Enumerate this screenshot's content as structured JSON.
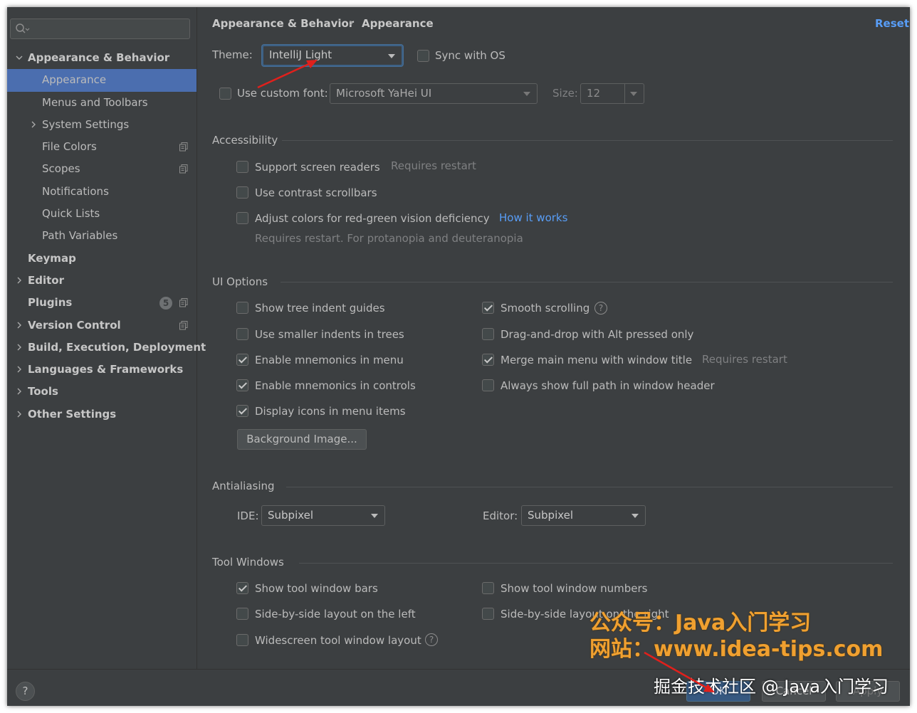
{
  "sidebar": {
    "search_placeholder": "",
    "items": [
      {
        "label": "Appearance & Behavior",
        "level": 1,
        "expanded": true
      },
      {
        "label": "Appearance",
        "level": 2,
        "selected": true
      },
      {
        "label": "Menus and Toolbars",
        "level": 2
      },
      {
        "label": "System Settings",
        "level": 2,
        "collapsed": true
      },
      {
        "label": "File Colors",
        "level": 2,
        "copy_icon": true
      },
      {
        "label": "Scopes",
        "level": 2,
        "copy_icon": true
      },
      {
        "label": "Notifications",
        "level": 2
      },
      {
        "label": "Quick Lists",
        "level": 2
      },
      {
        "label": "Path Variables",
        "level": 2
      },
      {
        "label": "Keymap",
        "level": 1
      },
      {
        "label": "Editor",
        "level": 1,
        "collapsed": true
      },
      {
        "label": "Plugins",
        "level": 1,
        "badge": "5",
        "copy_icon": true
      },
      {
        "label": "Version Control",
        "level": 1,
        "collapsed": true,
        "copy_icon": true
      },
      {
        "label": "Build, Execution, Deployment",
        "level": 1,
        "collapsed": true
      },
      {
        "label": "Languages & Frameworks",
        "level": 1,
        "collapsed": true
      },
      {
        "label": "Tools",
        "level": 1,
        "collapsed": true
      },
      {
        "label": "Other Settings",
        "level": 1,
        "collapsed": true
      }
    ]
  },
  "header": {
    "breadcrumb_parent": "Appearance & Behavior",
    "breadcrumb_sep": "›",
    "breadcrumb_current": "Appearance",
    "reset": "Reset"
  },
  "theme": {
    "label": "Theme:",
    "value": "IntelliJ Light",
    "sync_label": "Sync with OS",
    "sync_checked": false
  },
  "font": {
    "label": "Use custom font:",
    "checked": false,
    "value": "Microsoft YaHei UI",
    "size_label": "Size:",
    "size_value": "12"
  },
  "accessibility": {
    "title": "Accessibility",
    "screen_readers": "Support screen readers",
    "screen_readers_note": "Requires restart",
    "contrast_scrollbars": "Use contrast scrollbars",
    "adjust_colors": "Adjust colors for red-green vision deficiency",
    "how_it_works": "How it works",
    "adjust_note": "Requires restart. For protanopia and deuteranopia"
  },
  "ui_options": {
    "title": "UI Options",
    "left": [
      {
        "label": "Show tree indent guides",
        "checked": false
      },
      {
        "label": "Use smaller indents in trees",
        "checked": false
      },
      {
        "label": "Enable mnemonics in menu",
        "checked": true
      },
      {
        "label": "Enable mnemonics in controls",
        "checked": true
      },
      {
        "label": "Display icons in menu items",
        "checked": true
      }
    ],
    "right": [
      {
        "label": "Smooth scrolling",
        "checked": true
      },
      {
        "label": "Drag-and-drop with Alt pressed only",
        "checked": false
      },
      {
        "label": "Merge main menu with window title",
        "checked": true
      },
      {
        "label": "Always show full path in window header",
        "checked": false
      }
    ],
    "merge_note": "Requires restart",
    "background_button": "Background Image..."
  },
  "antialiasing": {
    "title": "Antialiasing",
    "ide_label": "IDE:",
    "ide_value": "Subpixel",
    "editor_label": "Editor:",
    "editor_value": "Subpixel"
  },
  "tool_windows": {
    "title": "Tool Windows",
    "show_bars": "Show tool window bars",
    "show_bars_checked": true,
    "show_numbers": "Show tool window numbers",
    "side_left": "Side-by-side layout on the left",
    "side_right": "Side-by-side layout on the right",
    "widescreen": "Widescreen tool window layout"
  },
  "footer": {
    "help": "?",
    "ok": "OK",
    "cancel": "Cancel",
    "apply": "Apply"
  },
  "watermark": {
    "line1": "公众号：Java入门学习",
    "line2": "网站：www.idea-tips.com",
    "line3": "掘金技术社区 @ Java入门学习"
  },
  "colors": {
    "background": "#3c3f41",
    "selection": "#4b6eaf",
    "link": "#589df6",
    "watermark": "#f0a030",
    "arrow": "#e0201c"
  }
}
